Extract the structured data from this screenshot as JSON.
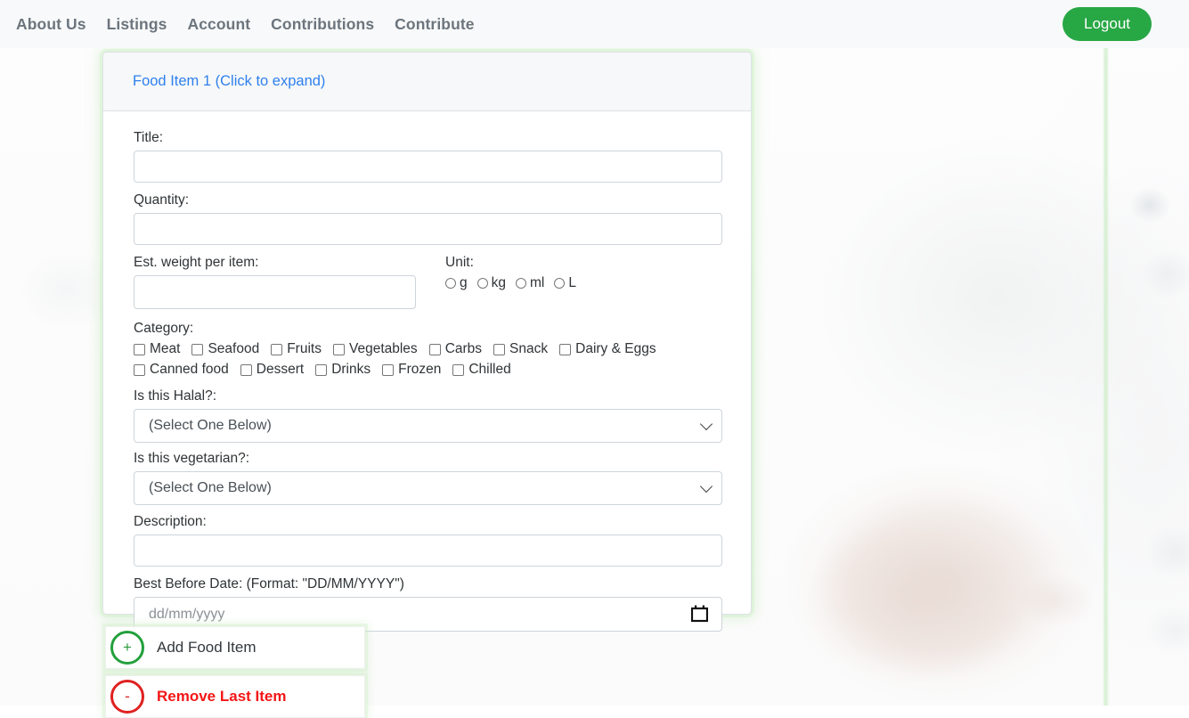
{
  "navbar": {
    "links": [
      {
        "label": "About Us",
        "name": "nav-link-about-us"
      },
      {
        "label": "Listings",
        "name": "nav-link-listings"
      },
      {
        "label": "Account",
        "name": "nav-link-account"
      },
      {
        "label": "Contributions",
        "name": "nav-link-contributions"
      },
      {
        "label": "Contribute",
        "name": "nav-link-contribute"
      }
    ],
    "logout_label": "Logout",
    "logout_color": "#28a745"
  },
  "food_item_card": {
    "header_link": "Food Item 1 (Click to expand)",
    "header_link_color": "#2f80ed",
    "fields": {
      "title_label": "Title:",
      "title_value": "",
      "quantity_label": "Quantity:",
      "quantity_value": "",
      "weight_label": "Est. weight per item:",
      "weight_value": "",
      "unit_label": "Unit:",
      "category_label": "Category:",
      "halal_label": "Is this Halal?:",
      "halal_value": "(Select One Below)",
      "vegetarian_label": "Is this vegetarian?:",
      "vegetarian_value": "(Select One Below)",
      "description_label": "Description:",
      "description_value": "",
      "best_before_label": "Best Before Date: (Format: \"DD/MM/YYYY\")",
      "best_before_placeholder": "dd/mm/yyyy"
    },
    "unit_options": [
      {
        "label": "g",
        "checked": false
      },
      {
        "label": "kg",
        "checked": false
      },
      {
        "label": "ml",
        "checked": false
      },
      {
        "label": "L",
        "checked": false
      }
    ],
    "category_options_row1": [
      {
        "label": "Meat",
        "checked": false
      },
      {
        "label": "Seafood",
        "checked": false
      },
      {
        "label": "Fruits",
        "checked": false
      },
      {
        "label": "Vegetables",
        "checked": false
      },
      {
        "label": "Carbs",
        "checked": false
      },
      {
        "label": "Snack",
        "checked": false
      },
      {
        "label": "Dairy & Eggs",
        "checked": false
      }
    ],
    "category_options_row2": [
      {
        "label": "Canned food",
        "checked": false
      },
      {
        "label": "Dessert",
        "checked": false
      },
      {
        "label": "Drinks",
        "checked": false
      },
      {
        "label": "Frozen",
        "checked": false
      },
      {
        "label": "Chilled",
        "checked": false
      }
    ]
  },
  "actions": {
    "add_label": "Add Food Item",
    "add_symbol": "+",
    "add_color": "#22a03c",
    "remove_label": "Remove Last Item",
    "remove_symbol": "-",
    "remove_color": "#e02020"
  }
}
